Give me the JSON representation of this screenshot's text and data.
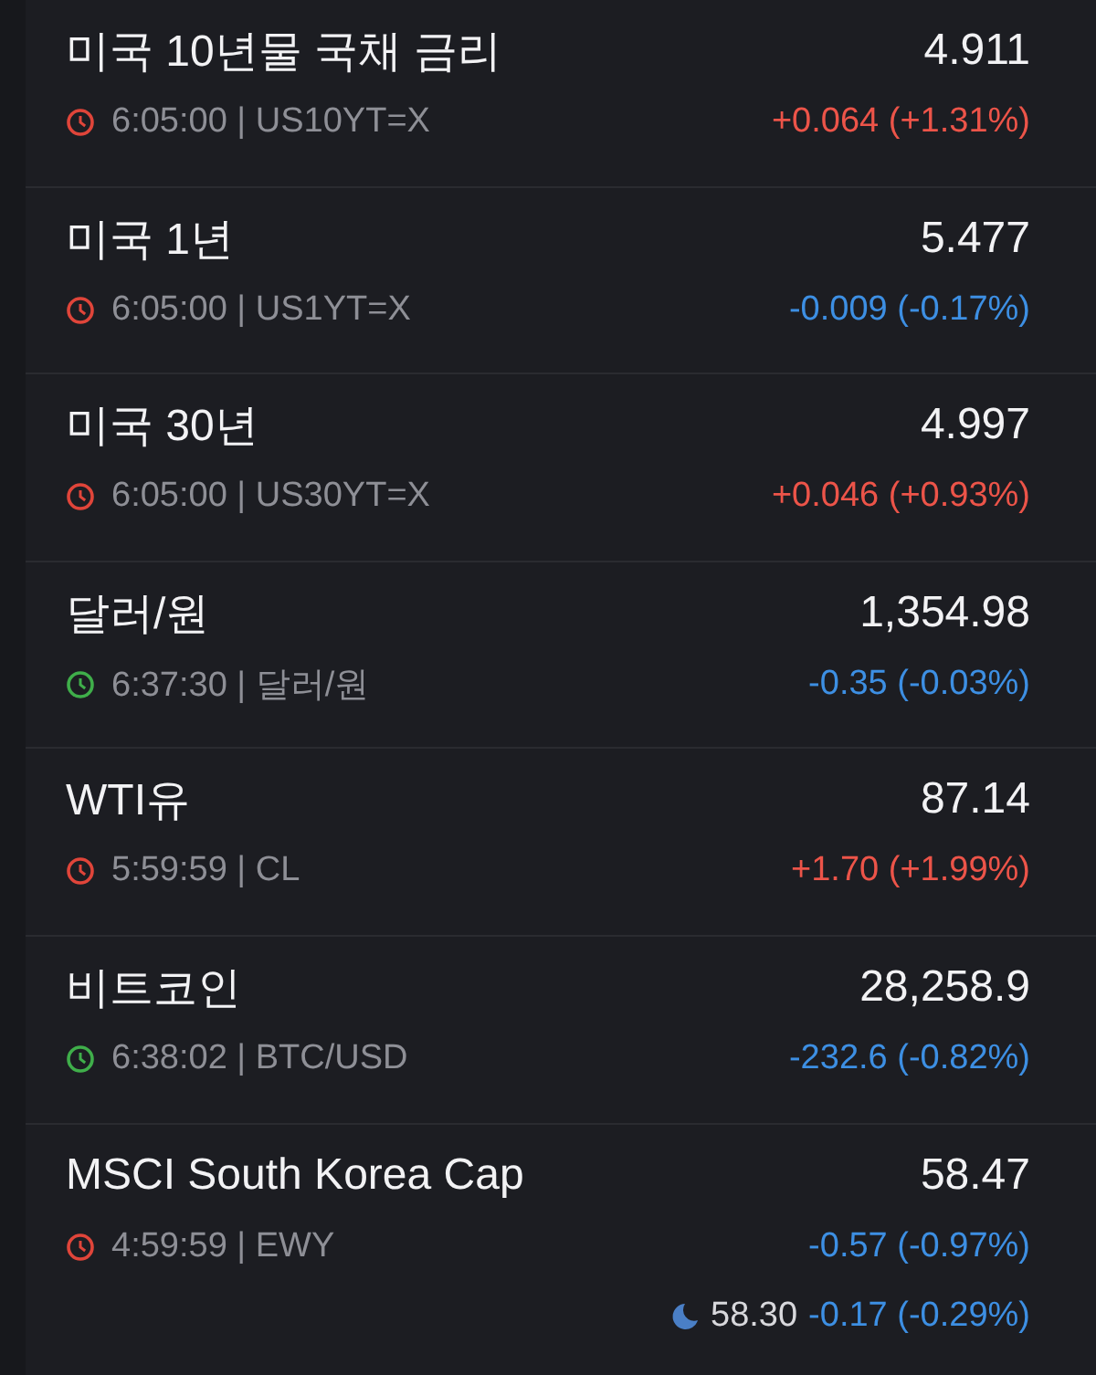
{
  "quotes": [
    {
      "name": "미국 10년물 국채 금리",
      "price": "4.911",
      "market_open": false,
      "meta": "6:05:00 | US10YT=X",
      "color": "#ec5449",
      "change": "+0.064 (+1.31%)"
    },
    {
      "name": "미국 1년",
      "price": "5.477",
      "market_open": false,
      "meta": "6:05:00 | US1YT=X",
      "color": "#3d8fe3",
      "change": "-0.009 (-0.17%)"
    },
    {
      "name": "미국 30년",
      "price": "4.997",
      "market_open": false,
      "meta": "6:05:00 | US30YT=X",
      "color": "#ec5449",
      "change": "+0.046 (+0.93%)"
    },
    {
      "name": "달러/원",
      "price": "1,354.98",
      "market_open": true,
      "meta": "6:37:30 | 달러/원",
      "color": "#3d8fe3",
      "change": "-0.35 (-0.03%)"
    },
    {
      "name": "WTI유",
      "price": "87.14",
      "market_open": false,
      "meta": "5:59:59 | CL",
      "color": "#ec5449",
      "change": "+1.70 (+1.99%)"
    },
    {
      "name": "비트코인",
      "price": "28,258.9",
      "market_open": true,
      "meta": "6:38:02 | BTC/USD",
      "color": "#3d8fe3",
      "change": "-232.6 (-0.82%)"
    },
    {
      "name": "MSCI South Korea Cap",
      "price": "58.47",
      "market_open": false,
      "meta": "4:59:59 | EWY",
      "color": "#3d8fe3",
      "change": "-0.57 (-0.97%)",
      "after_hours": {
        "price": "58.30",
        "color": "#3d8fe3",
        "change": "-0.17 (-0.29%)"
      }
    }
  ]
}
